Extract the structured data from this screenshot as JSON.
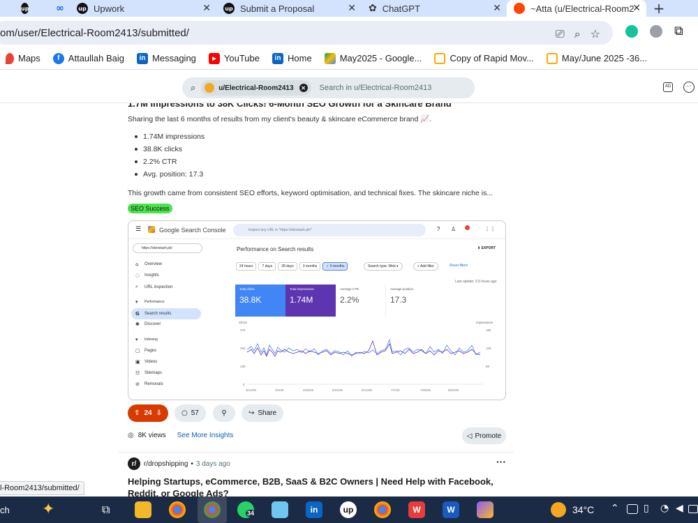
{
  "browser": {
    "tabs": [
      {
        "label": "",
        "icon": "upwork-icon"
      },
      {
        "label": "",
        "icon": "meta-icon"
      },
      {
        "label": "Upwork",
        "icon": "upwork-icon"
      },
      {
        "label": "Submit a Proposal",
        "icon": "upwork-icon"
      },
      {
        "label": "ChatGPT",
        "icon": "chatgpt-icon"
      },
      {
        "label": "~Atta (u/Electrical-Room2",
        "icon": "reddit-icon"
      }
    ],
    "close_glyph": "✕",
    "new_tab": "+",
    "url": "om/user/Electrical-Room2413/submitted/",
    "bookmarks": [
      {
        "label": "Maps",
        "icon": "maps-icon",
        "color": "#ea4335"
      },
      {
        "label": "Attaullah Baig",
        "icon": "facebook-icon",
        "color": "#1877f2"
      },
      {
        "label": "Messaging",
        "icon": "linkedin-icon",
        "color": "#0a66c2"
      },
      {
        "label": "YouTube",
        "icon": "youtube-icon",
        "color": "#ff0000"
      },
      {
        "label": "Home",
        "icon": "linkedin-icon",
        "color": "#0a66c2"
      },
      {
        "label": "May2025 - Google...",
        "icon": "drive-icon",
        "color": "#fbbc04"
      },
      {
        "label": "Copy of Rapid Mov...",
        "icon": "folder-icon",
        "color": "#f9ab00"
      },
      {
        "label": "May/June 2025 -36...",
        "icon": "folder-icon",
        "color": "#f9ab00"
      }
    ]
  },
  "reddit": {
    "search_chip": "u/Electrical-Room2413",
    "search_placeholder": "Search in u/Electrical-Room2413"
  },
  "post": {
    "title": "1.7M Impressions to 38K Clicks! 6-Month SEO Growth for a Skincare Brand",
    "subtitle": "Sharing the last 6 months of results from my client's beauty & skincare eCommerce brand 📈.",
    "bullets": [
      "1.74M impressions",
      "38.8K clicks",
      "2.2% CTR",
      "Avg. position: 17.3"
    ],
    "body": "This growth came from consistent SEO efforts, keyword optimisation, and technical fixes. The skincare niche is...",
    "flair": "SEO Success",
    "votes": "24",
    "comments": "57",
    "share": "Share",
    "views": "8K views",
    "insights": "See More Insights",
    "promote": "Promote"
  },
  "gsc": {
    "logo": "Google Search Console",
    "inspect_placeholder": "Inspect any URL in \"https://skinstash.pk/\"",
    "property": "https://skinstash.pk/",
    "heading": "Performance on Search results",
    "export": "EXPORT",
    "ranges": [
      "24 hours",
      "7 days",
      "28 days",
      "3 months",
      "✓ 6 months"
    ],
    "search_type": "Search type: Web ▾",
    "add_filter": "+ Add filter",
    "reset": "Reset filters",
    "last_update": "Last update: 2.5 hours ago",
    "side": [
      {
        "label": "Overview",
        "icon": "⌂"
      },
      {
        "label": "Insights",
        "icon": "◌"
      },
      {
        "label": "URL inspection",
        "icon": "⌕"
      },
      {
        "label": "Performance",
        "icon": "▾"
      },
      {
        "label": "Search results",
        "icon": "G"
      },
      {
        "label": "Discover",
        "icon": "✱"
      },
      {
        "label": "Indexing",
        "icon": "▾"
      },
      {
        "label": "Pages",
        "icon": "▢"
      },
      {
        "label": "Videos",
        "icon": "▣"
      },
      {
        "label": "Sitemaps",
        "icon": "☷"
      },
      {
        "label": "Removals",
        "icon": "⊘"
      }
    ],
    "cards": [
      {
        "label": "Total clicks",
        "value": "38.8K",
        "bg": "#4285f4"
      },
      {
        "label": "Total impressions",
        "value": "1.74M",
        "bg": "#5e35b1"
      },
      {
        "label": "Average CTR",
        "value": "2.2%",
        "bg": "#ffffff"
      },
      {
        "label": "Average position",
        "value": "17.3",
        "bg": "#ffffff"
      }
    ],
    "chart_left_label": "Clicks",
    "chart_right_label": "Impressions",
    "left_ticks": [
      "375",
      "250",
      "125",
      "0"
    ],
    "right_ticks": [
      "18K",
      "12K",
      "6K",
      ""
    ],
    "dates": [
      "3/14/25",
      "4/4/25",
      "4/29/25",
      "5/22/25",
      "6/14/25",
      "7/7/25",
      "7/30/25",
      "8/22/25"
    ]
  },
  "next_post": {
    "subreddit": "r/dropshipping",
    "age": "3 days ago",
    "title": "Helping Startups, eCommerce, B2B, SaaS & B2C Owners | Need Help with Facebook, Reddit, or Google Ads?"
  },
  "status_url": "l-Room2413/submitted/",
  "taskbar": {
    "search_label": "ch",
    "temperature": "34°C",
    "whatsapp_badge": "34"
  }
}
